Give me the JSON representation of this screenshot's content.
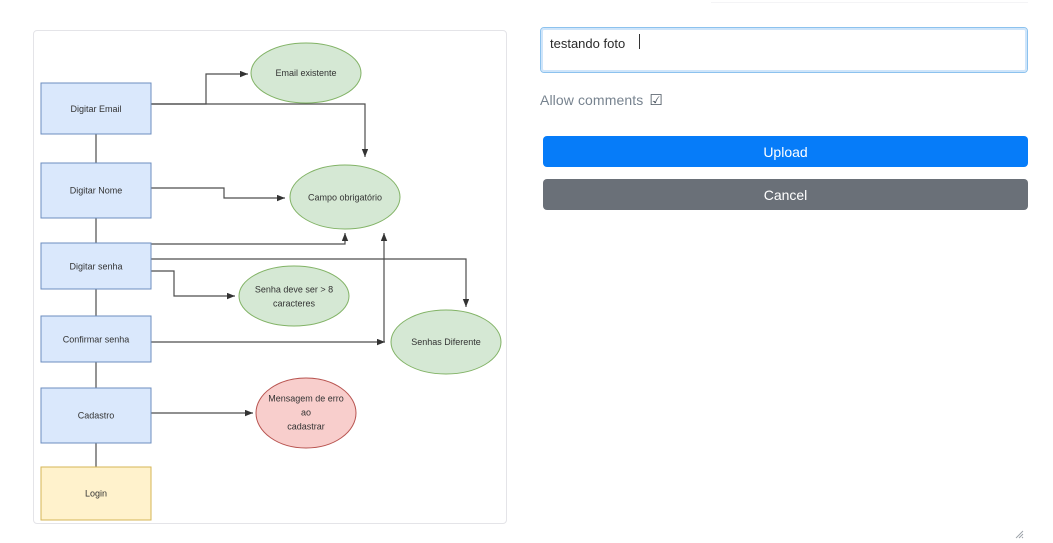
{
  "diagram": {
    "nodes": [
      {
        "id": "digitar-email",
        "label": "Digitar Email",
        "shape": "box",
        "color": "blue"
      },
      {
        "id": "digitar-nome",
        "label": "Digitar Nome",
        "shape": "box",
        "color": "blue"
      },
      {
        "id": "digitar-senha",
        "label": "Digitar senha",
        "shape": "box",
        "color": "blue"
      },
      {
        "id": "confirmar-senha",
        "label": "Confirmar senha",
        "shape": "box",
        "color": "blue"
      },
      {
        "id": "cadastro",
        "label": "Cadastro",
        "shape": "box",
        "color": "blue"
      },
      {
        "id": "login",
        "label": "Login",
        "shape": "box",
        "color": "yellow"
      },
      {
        "id": "email-existente",
        "label": "Email existente",
        "shape": "ellipse",
        "color": "green"
      },
      {
        "id": "campo-obrigatorio",
        "label": "Campo obrigatório",
        "shape": "ellipse",
        "color": "green"
      },
      {
        "id": "senha-8",
        "label_line1": "Senha deve ser > 8",
        "label_line2": "caracteres",
        "shape": "ellipse",
        "color": "green"
      },
      {
        "id": "senhas-diferente",
        "label": "Senhas Diferente",
        "shape": "ellipse",
        "color": "green"
      },
      {
        "id": "erro-cadastro",
        "label_line1": "Mensagem de erro",
        "label_line2": "ao",
        "label_line3": "cadastrar",
        "shape": "ellipse",
        "color": "red"
      }
    ],
    "colors": {
      "blue_fill": "#dae8fc",
      "blue_stroke": "#6c8ebf",
      "green_fill": "#d5e8d4",
      "green_stroke": "#82b366",
      "red_fill": "#f8cecc",
      "red_stroke": "#b85450",
      "yellow_fill": "#fff2cc",
      "yellow_stroke": "#d6b656",
      "edge": "#4d4d4d"
    }
  },
  "form": {
    "caption": {
      "value": "testando foto",
      "placeholder": ""
    },
    "allow_comments": {
      "label": "Allow comments",
      "checkbox_glyph": "☑",
      "checked": true
    },
    "upload_label": "Upload",
    "cancel_label": "Cancel",
    "colors": {
      "upload_bg": "#067cf9",
      "cancel_bg": "#6a7078",
      "focus_border": "#8cc2ee",
      "label_text": "#77838f"
    }
  }
}
